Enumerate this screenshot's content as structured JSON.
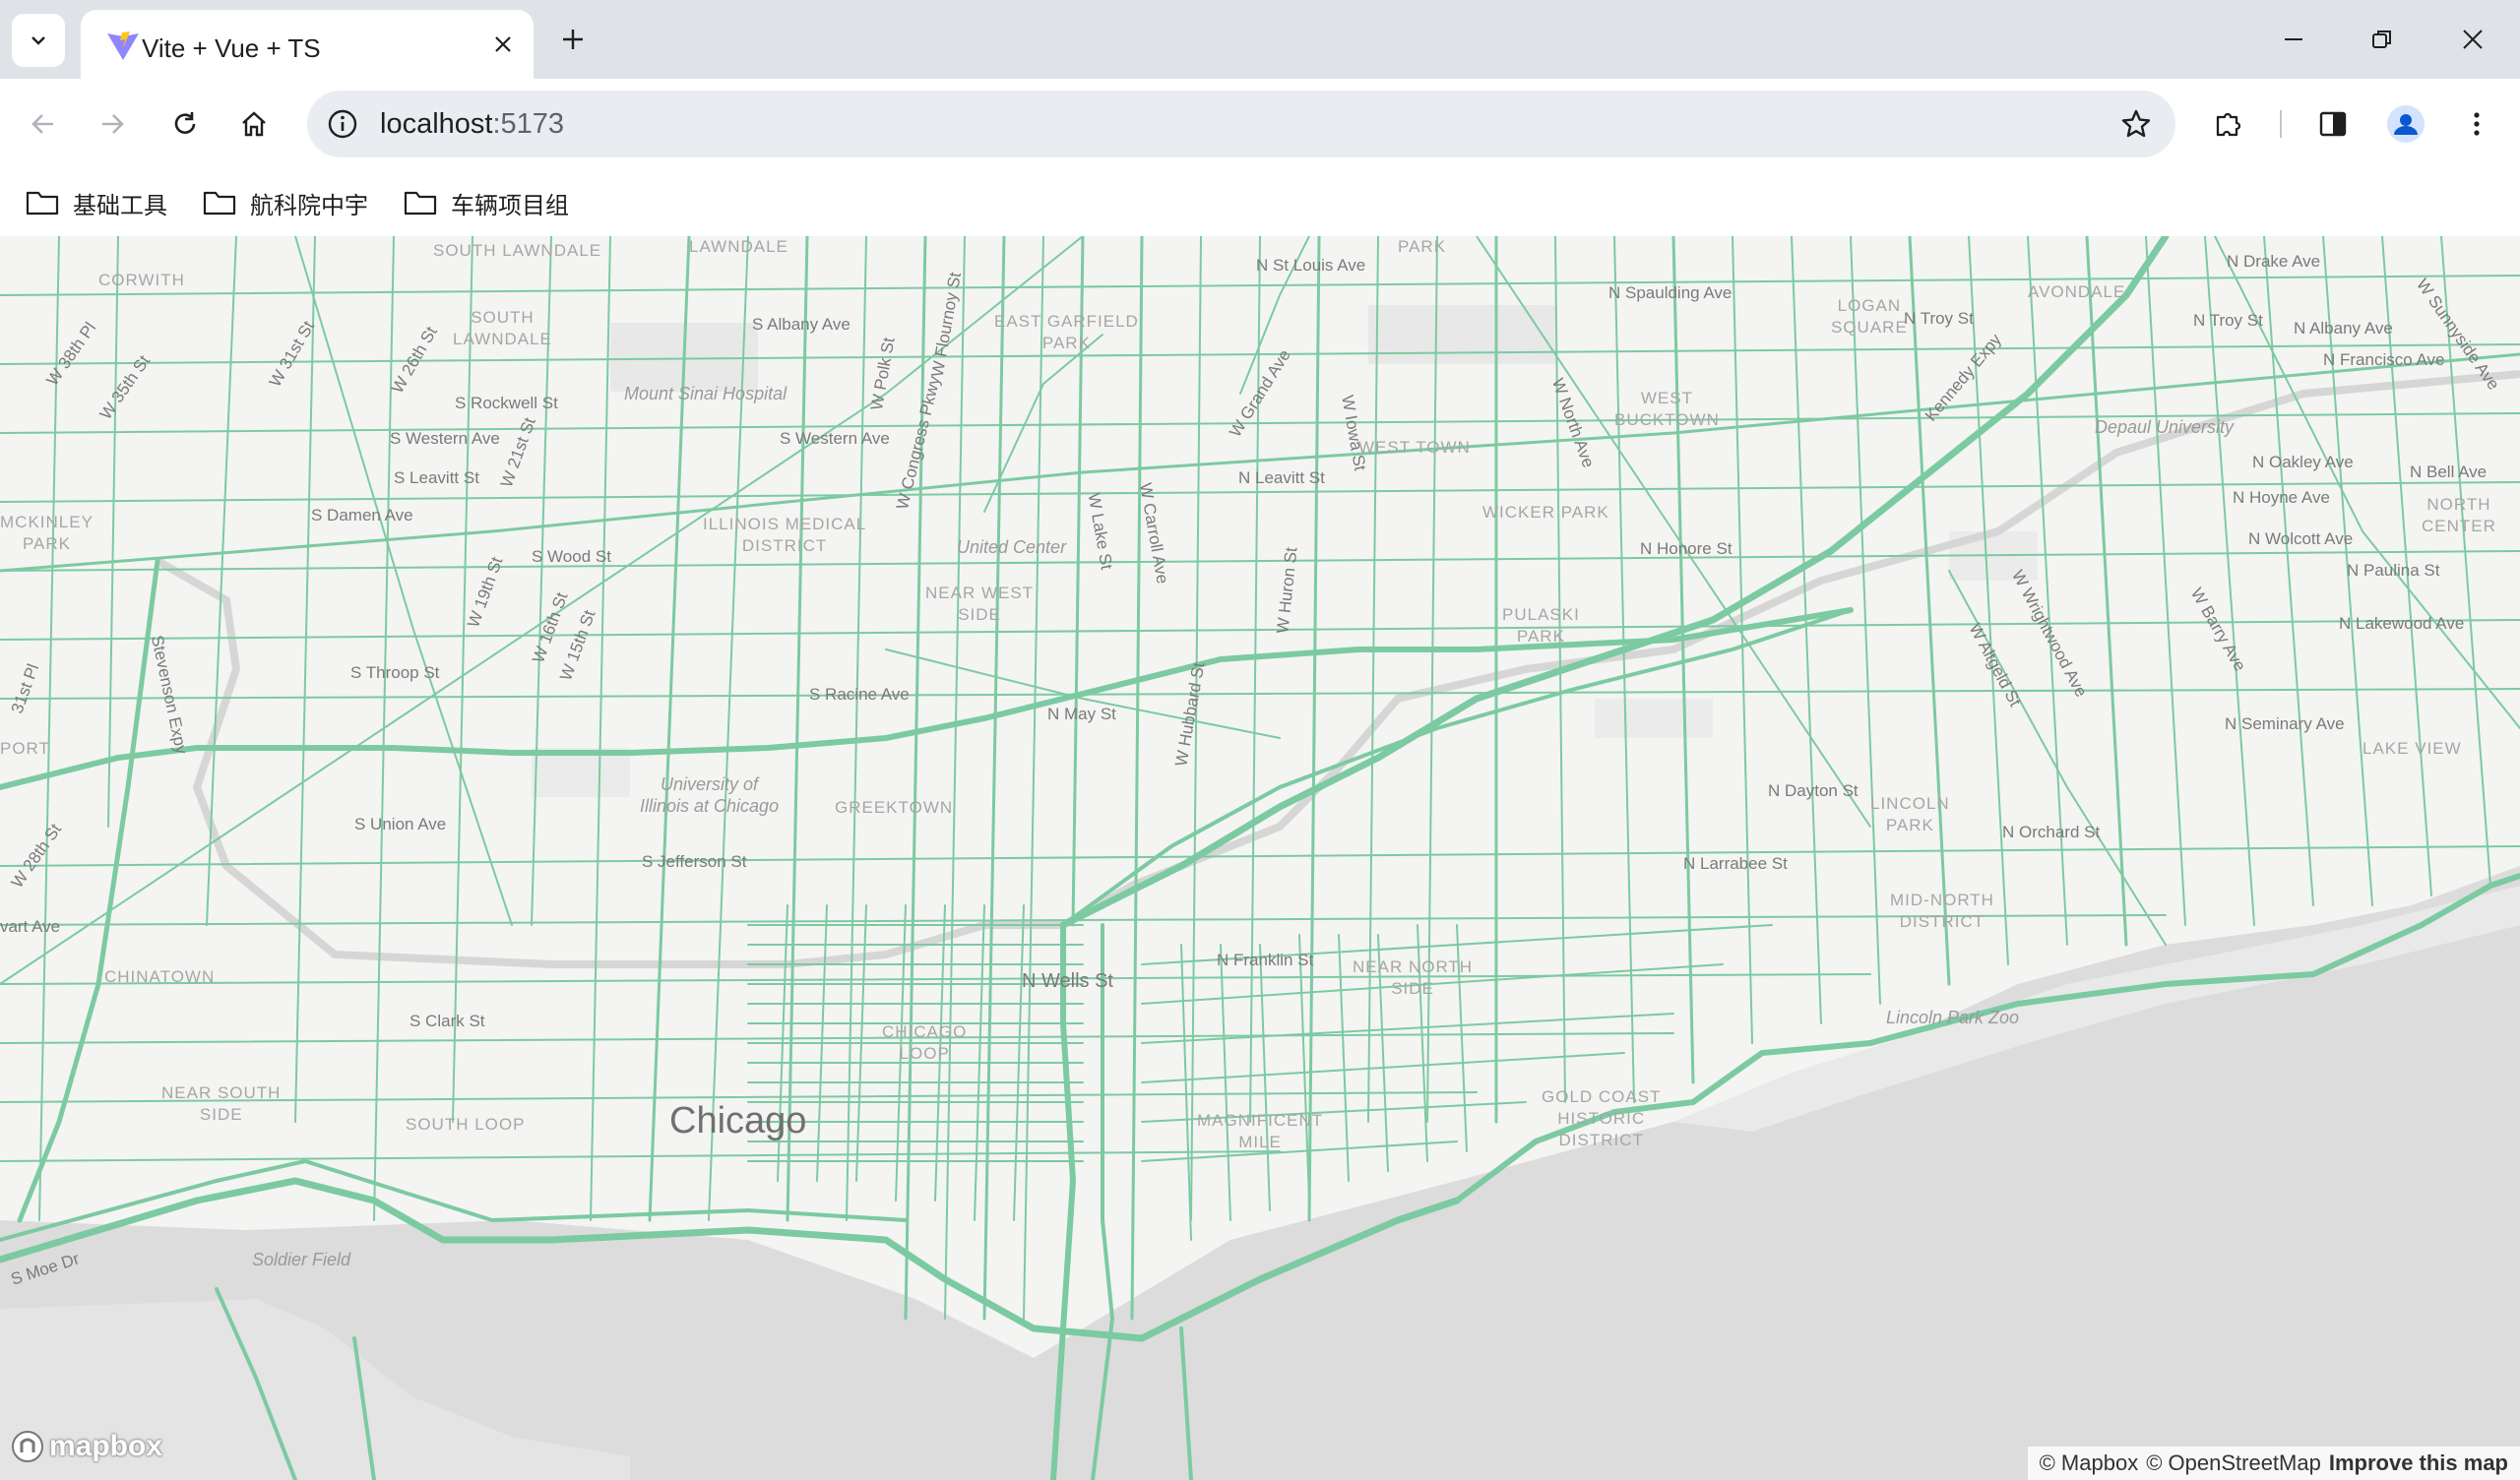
{
  "browser": {
    "tab": {
      "title": "Vite + Vue + TS",
      "favicon": "vite-icon"
    },
    "window_controls": [
      "minimize-icon",
      "restore-icon",
      "close-icon"
    ],
    "address": {
      "host": "localhost",
      "port": ":5173"
    },
    "bookmarks": [
      {
        "label": "基础工具",
        "icon": "folder-icon"
      },
      {
        "label": "航科院中宇",
        "icon": "folder-icon"
      },
      {
        "label": "车辆项目组",
        "icon": "folder-icon"
      }
    ]
  },
  "map": {
    "colors": {
      "network": "#7ccaa1",
      "land": "#f4f4f3",
      "water": "#dcdcdc",
      "park": "#e8e8e8"
    },
    "city_label": "Chicago",
    "neighborhoods": {
      "south_lawndale_top": "SOUTH\nLAWNDALE",
      "lawndale": "LAWNDALE",
      "corwith": "CORWITH",
      "south_lawndale": "SOUTH\nLAWNDALE",
      "east_garfield": "EAST GARFIELD\nPARK",
      "park_top": "PARK",
      "logan_square": "LOGAN\nSQUARE",
      "avondale": "AVONDALE",
      "west_bucktown": "WEST\nBUCKTOWN",
      "west_town": "WEST TOWN",
      "illinois_medical": "ILLINOIS MEDICAL\nDISTRICT",
      "wicker_park": "WICKER PARK",
      "near_west_side": "NEAR WEST\nSIDE",
      "pulaski_park": "PULASKI\nPARK",
      "mckinley_park": "MCKINLEY\nPARK",
      "greektown": "GREEKTOWN",
      "lincoln_park": "LINCOLN\nPARK",
      "mid_north": "MID-NORTH\nDISTRICT",
      "lake_view": "LAKE VIEW",
      "north_center": "NORTH\nCENTER",
      "chinatown": "CHINATOWN",
      "near_north": "NEAR NORTH\nSIDE",
      "chicago_loop": "CHICAGO\nLOOP",
      "near_south": "NEAR SOUTH\nSIDE",
      "south_loop": "SOUTH LOOP",
      "magnificent_mile": "MAGNIFICENT\nMILE",
      "gold_coast": "GOLD COAST\nHISTORIC\nDISTRICT",
      "port": "PORT"
    },
    "pois": {
      "mount_sinai": "Mount Sinai Hospital",
      "united_center": "United Center",
      "uic": "University of\nIllinois at Chicago",
      "depaul": "Depaul University",
      "lincoln_park_zoo": "Lincoln Park Zoo",
      "soldier_field": "Soldier Field"
    },
    "streets": {
      "st_louis": "N St Louis Ave",
      "spaulding": "N Spaulding Ave",
      "drake": "N Drake Ave",
      "troy_1": "N Troy St",
      "troy_2": "N Troy St",
      "albany_n": "N Albany Ave",
      "francisco": "N Francisco Ave",
      "sunnyside": "W Sunnyside Ave",
      "albany_s": "S Albany Ave",
      "rockwell": "S Rockwell St",
      "western_1": "S Western Ave",
      "western_2": "S Western Ave",
      "leavitt_s": "S Leavitt St",
      "leavitt_n": "N Leavitt St",
      "damen": "S Damen Ave",
      "wood": "S Wood St",
      "throop": "S Throop St",
      "racine": "S Racine Ave",
      "may": "N May St",
      "union": "S Union Ave",
      "jefferson": "S Jefferson St",
      "dayton": "N Dayton St",
      "larrabee": "N Larrabee St",
      "orchard": "N Orchard St",
      "honore": "N Honore St",
      "oakley": "N Oakley Ave",
      "hoyne": "N Hoyne Ave",
      "wolcott": "N Wolcott Ave",
      "paulina": "N Paulina St",
      "bell": "N Bell Ave",
      "lakewood": "N Lakewood Ave",
      "seminary": "N Seminary Ave",
      "franklin": "N Franklin St",
      "wells": "N Wells St",
      "clark": "S Clark St",
      "moe": "S Moe Dr",
      "w31st": "W 31st St",
      "w26th": "W 26th St",
      "w21st": "W 21st St",
      "w19th": "W 19th St",
      "w16th": "W 16th St",
      "w15th": "W 15th St",
      "w28th": "W 28th St",
      "w38th": "W 38th Pl",
      "w35th": "W 35th St",
      "stevenson": "Stevenson Expy",
      "polk": "W Polk St",
      "flournoy": "W Flournoy St",
      "congress": "W Congress Pkwy",
      "lake": "W Lake St",
      "carroll": "W Carroll Ave",
      "hubbard": "W Hubbard St",
      "grand": "W Grand Ave",
      "iowa": "W Iowa St",
      "huron": "W Huron St",
      "north_ave": "W North Ave",
      "kennedy": "Kennedy Expy",
      "wrightwood": "W Wrightwood Ave",
      "altgeld": "W Altgeld St",
      "barry": "W Barry Ave",
      "ave_left": "vart Ave",
      "st_left": "St",
      "pl_left": "31st Pl"
    },
    "logo": "mapbox",
    "attribution": {
      "mapbox": "© Mapbox",
      "osm": "© OpenStreetMap",
      "improve": "Improve this map"
    }
  }
}
